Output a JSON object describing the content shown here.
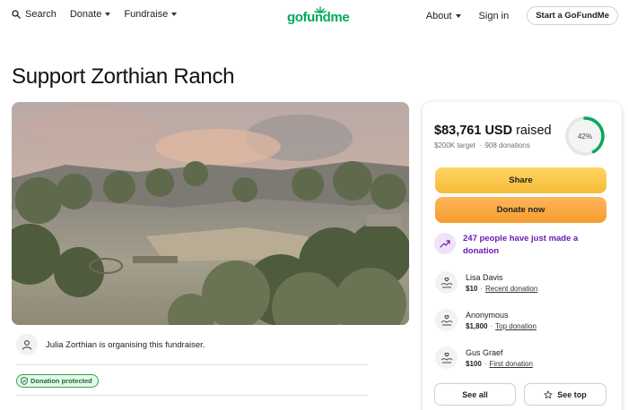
{
  "header": {
    "search_label": "Search",
    "donate_label": "Donate",
    "fundraise_label": "Fundraise",
    "logo_text": "gofundme",
    "about_label": "About",
    "signin_label": "Sign in",
    "start_label": "Start a GoFundMe"
  },
  "page": {
    "title": "Support Zorthian Ranch",
    "organiser_text": "Julia Zorthian is organising this fundraiser.",
    "protected_label": "Donation protected"
  },
  "card": {
    "raised_amount": "$83,761 USD",
    "raised_suffix": "raised",
    "target": "$200K target",
    "donations_count": "908 donations",
    "progress_label": "42%",
    "progress_value": 0.42,
    "share_label": "Share",
    "donate_now_label": "Donate now",
    "trending_text": "247 people have just made a donation",
    "donations": [
      {
        "name": "Lisa Davis",
        "amount": "$10",
        "tag": "Recent donation"
      },
      {
        "name": "Anonymous",
        "amount": "$1,800",
        "tag": "Top donation"
      },
      {
        "name": "Gus Graef",
        "amount": "$100",
        "tag": "First donation"
      }
    ],
    "see_all_label": "See all",
    "see_top_label": "See top"
  },
  "colors": {
    "brand_green": "#02a95c",
    "share_yellow": "#f6bb3a",
    "donate_orange": "#f59d2c",
    "trending_purple": "#6b1bb4",
    "protected_green": "#30a64a"
  }
}
